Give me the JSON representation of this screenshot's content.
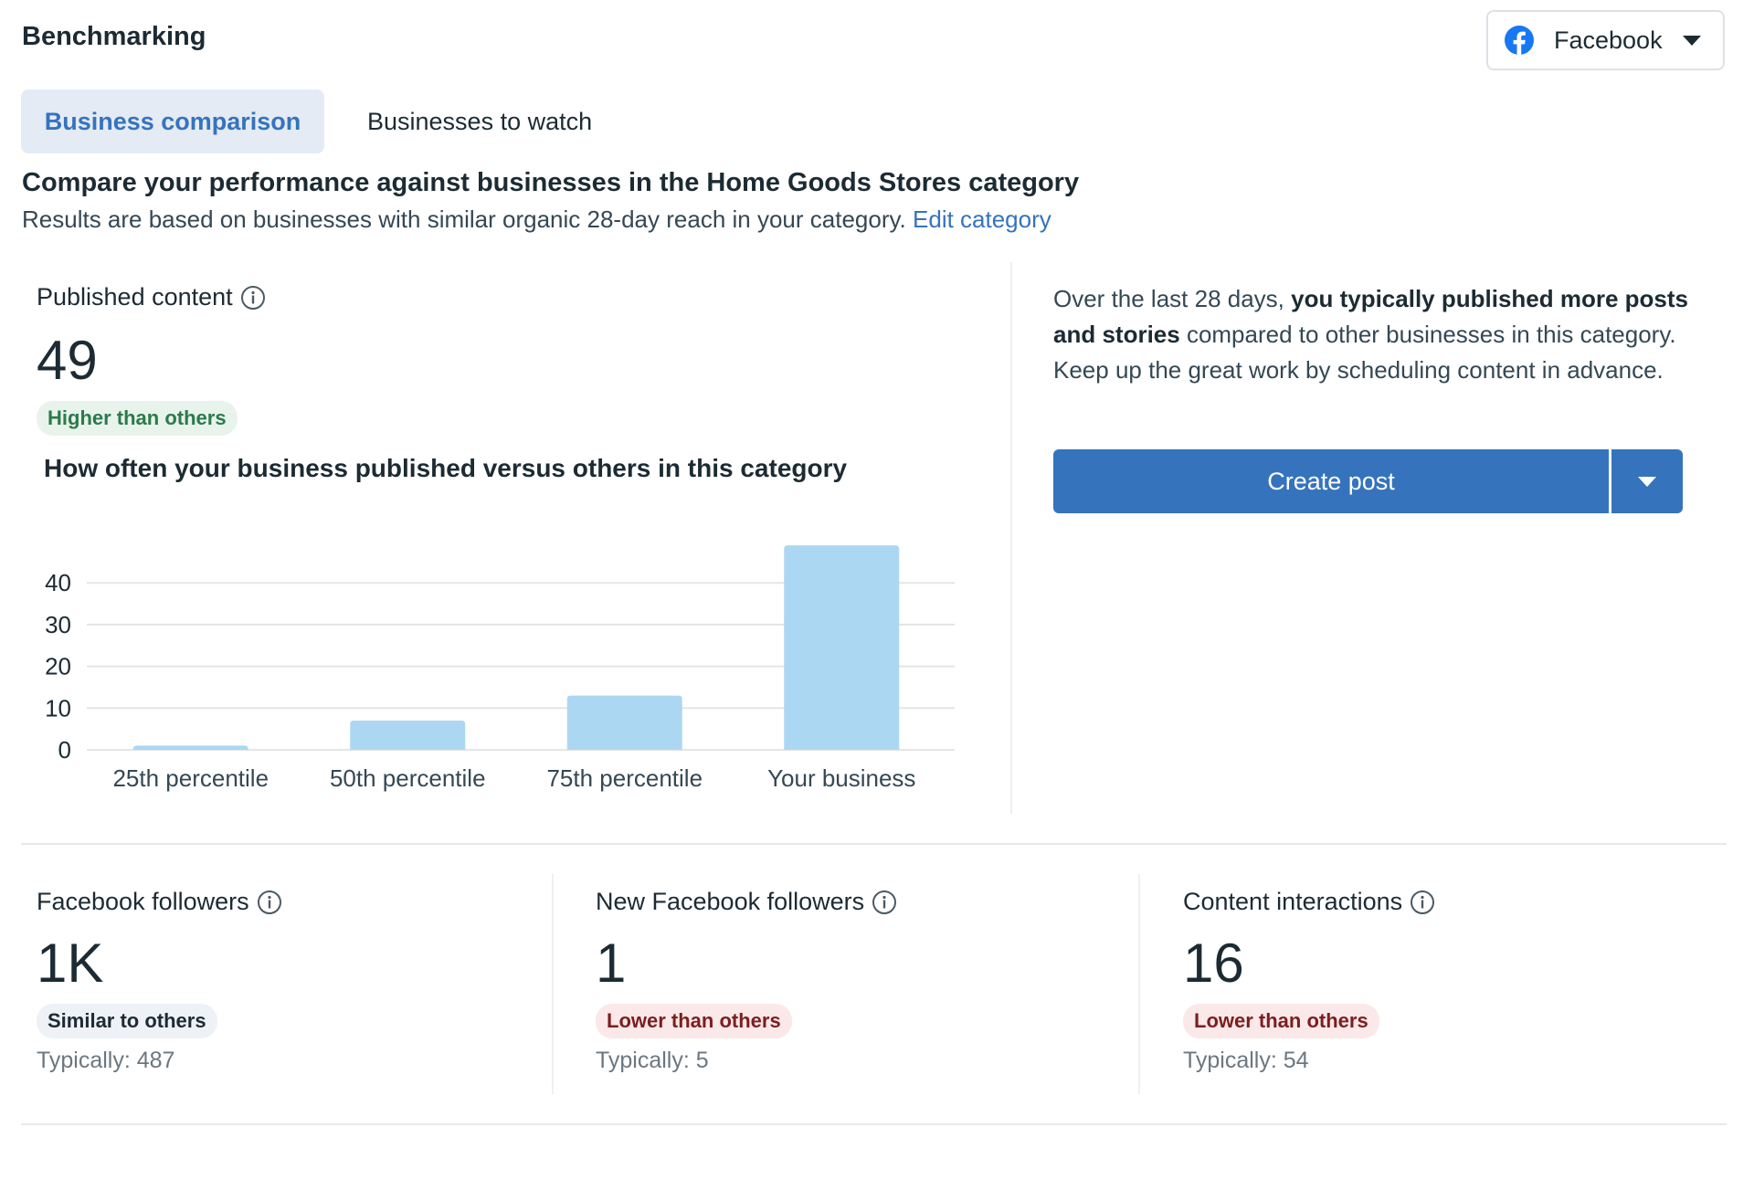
{
  "header": {
    "title": "Benchmarking",
    "platform_selector": {
      "selected": "Facebook",
      "icon": "facebook-icon"
    }
  },
  "tabs": [
    {
      "label": "Business comparison",
      "active": true
    },
    {
      "label": "Businesses to watch",
      "active": false
    }
  ],
  "intro": {
    "headline": "Compare your performance against businesses in the Home Goods Stores category",
    "subline": "Results are based on businesses with similar organic 28-day reach in your category.",
    "edit_link": "Edit category"
  },
  "published_content": {
    "label": "Published content",
    "value": "49",
    "badge": "Higher than others",
    "chart_title": "How often your business published versus others in this category"
  },
  "insight": {
    "text_before": "Over the last 28 days, ",
    "text_bold": "you typically published more posts and stories",
    "text_after": " compared to other businesses in this category. Keep up the great work by scheduling content in advance.",
    "primary_button": "Create post",
    "dropdown_icon": "caret-down-icon"
  },
  "metrics": [
    {
      "label": "Facebook followers",
      "value": "1K",
      "badge": "Similar to others",
      "badge_type": "neutral",
      "typical": "Typically: 487"
    },
    {
      "label": "New Facebook followers",
      "value": "1",
      "badge": "Lower than others",
      "badge_type": "red",
      "typical": "Typically: 5"
    },
    {
      "label": "Content interactions",
      "value": "16",
      "badge": "Lower than others",
      "badge_type": "red",
      "typical": "Typically: 54"
    }
  ],
  "colors": {
    "accent": "#3573bd",
    "bar": "#acd7f2",
    "grid": "#e3e5e8",
    "badge_green_text": "#2c7a4b",
    "badge_red_text": "#7a1f1f"
  },
  "chart_data": {
    "type": "bar",
    "title": "How often your business published versus others in this category",
    "categories": [
      "25th percentile",
      "50th percentile",
      "75th percentile",
      "Your business"
    ],
    "values": [
      1,
      7,
      13,
      49
    ],
    "xlabel": "",
    "ylabel": "",
    "yticks": [
      0,
      10,
      20,
      30,
      40
    ],
    "ylim": [
      0,
      49
    ],
    "grid": true,
    "legend": "none"
  }
}
